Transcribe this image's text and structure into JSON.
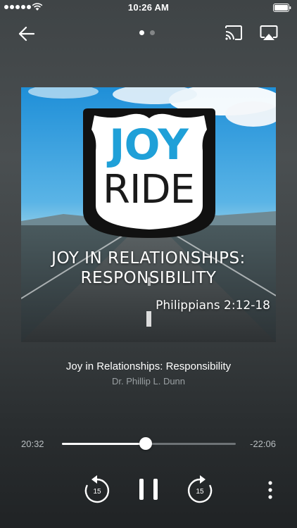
{
  "status_bar": {
    "time": "10:26 AM"
  },
  "artwork": {
    "logo_line1": "JOY",
    "logo_line2": "RIDE",
    "title_line1": "JOY IN RELATIONSHIPS:",
    "title_line2": "RESPONSIBILITY",
    "verse": "Philippians 2:12-18"
  },
  "track": {
    "title": "Joy in Relationships: Responsibility",
    "artist": "Dr. Phillip L. Dunn"
  },
  "progress": {
    "elapsed": "20:32",
    "remaining": "-22:06",
    "fraction": 0.48
  },
  "controls": {
    "rewind_seconds": "15",
    "forward_seconds": "15"
  },
  "pager": {
    "pages": 2,
    "current": 1
  },
  "icons": {
    "back": "arrow-left-icon",
    "cast": "cast-icon",
    "airplay": "airplay-icon",
    "rewind": "rewind-15-icon",
    "pause": "pause-icon",
    "forward": "forward-15-icon",
    "more": "more-vertical-icon"
  },
  "colors": {
    "accent_blue": "#1fa0d8",
    "background_top": "#3f4446",
    "background_bottom": "#202325"
  }
}
